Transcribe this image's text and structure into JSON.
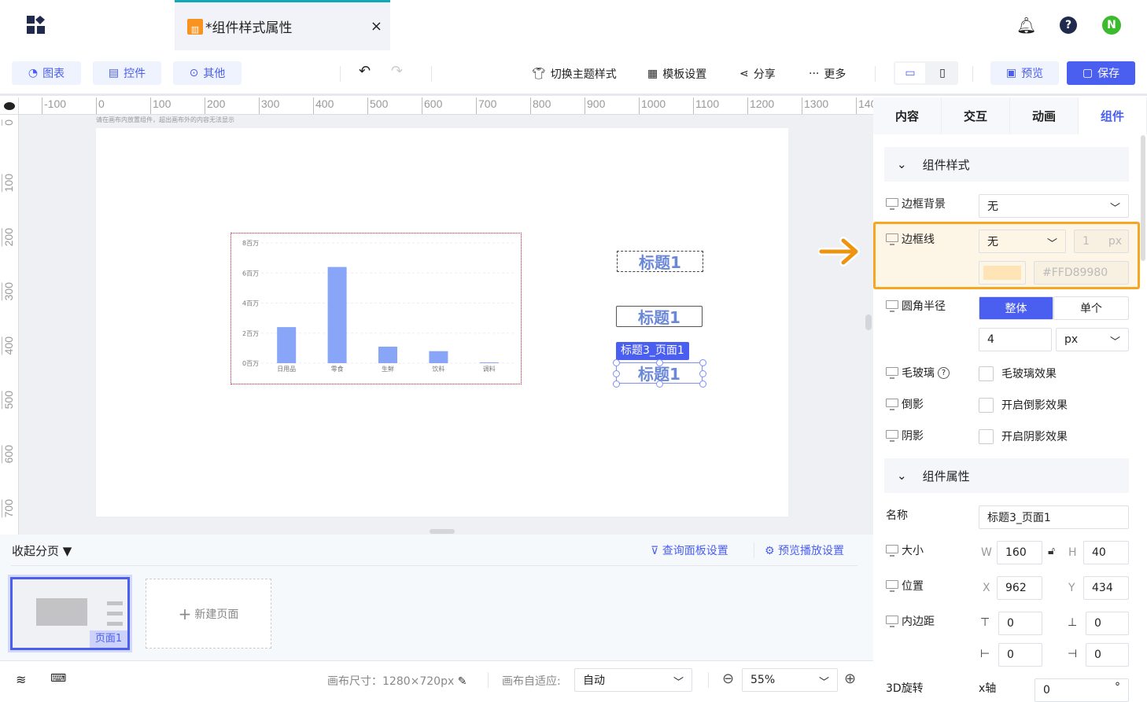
{
  "header": {
    "app_icon": "apps-grid-icon",
    "tab_title": "*组件样式属性",
    "tab_icon": "chart-file-icon",
    "close": "×",
    "avatar": "N",
    "colors": {
      "tab_accent": "#13a8b8",
      "avatar": "#3dbb2f"
    }
  },
  "toolbar": {
    "chart_btn": "图表",
    "control_btn": "控件",
    "other_btn": "其他",
    "theme": "切换主题样式",
    "template": "模板设置",
    "share": "分享",
    "more": "更多",
    "preview": "预览",
    "save": "保存",
    "accent": "#4a5ef0"
  },
  "ruler": {
    "h": [
      "-100",
      "0",
      "100",
      "200",
      "300",
      "400",
      "500",
      "600",
      "700",
      "800",
      "900",
      "1000",
      "1100",
      "1200",
      "1300",
      "140"
    ],
    "v": [
      "0",
      "100",
      "200",
      "300",
      "400",
      "500",
      "600",
      "700"
    ]
  },
  "canvas": {
    "hint": "请在画布内放置组件，超出画布外的内容无法显示",
    "titles": [
      "标题1",
      "标题1",
      "标题1"
    ],
    "selected_tag": "标题3_页面1"
  },
  "chart_data": {
    "type": "bar",
    "categories": [
      "日用品",
      "零食",
      "生鲜",
      "饮料",
      "调料"
    ],
    "values": [
      2.4,
      6.4,
      1.1,
      0.8,
      0.05
    ],
    "yticks": [
      "0百万",
      "2百万",
      "4百万",
      "6百万",
      "8百万"
    ],
    "ylim": [
      0,
      8
    ],
    "grid": true,
    "color": "#88a5f7"
  },
  "panel": {
    "tabs": [
      "内容",
      "交互",
      "动画",
      "组件"
    ],
    "section_style": "组件样式",
    "border_bg": {
      "label": "边框背景",
      "value": "无"
    },
    "border_line": {
      "label": "边框线",
      "value": "无",
      "width": "1",
      "unit": "px",
      "color": "#FFD89980",
      "swatch": "#ffe4b5"
    },
    "radius": {
      "label": "圆角半径",
      "opt_whole": "整体",
      "opt_single": "单个",
      "value": "4",
      "unit": "px"
    },
    "glass": {
      "label": "毛玻璃",
      "check": "毛玻璃效果"
    },
    "reflect": {
      "label": "倒影",
      "check": "开启倒影效果"
    },
    "shadow": {
      "label": "阴影",
      "check": "开启阴影效果"
    },
    "section_props": "组件属性",
    "name": {
      "label": "名称",
      "value": "标题3_页面1"
    },
    "size": {
      "label": "大小",
      "w_label": "W",
      "w": "160",
      "h_label": "H",
      "h": "40"
    },
    "pos": {
      "label": "位置",
      "x_label": "X",
      "x": "962",
      "y_label": "Y",
      "y": "434"
    },
    "padding": {
      "label": "内边距",
      "top": "0",
      "bottom": "0",
      "left": "0",
      "right": "0"
    },
    "rotate": {
      "label": "3D旋转",
      "axis": "x轴",
      "value": "0",
      "unit": "°"
    }
  },
  "pages": {
    "collapse": "收起分页",
    "query": "查询面板设置",
    "play": "预览播放设置",
    "page1": "页面1",
    "new_page": "新建页面"
  },
  "footer": {
    "size_label": "画布尺寸：",
    "size": "1280×720px",
    "fit_label": "画布自适应:",
    "fit": "自动",
    "zoom": "55%"
  }
}
